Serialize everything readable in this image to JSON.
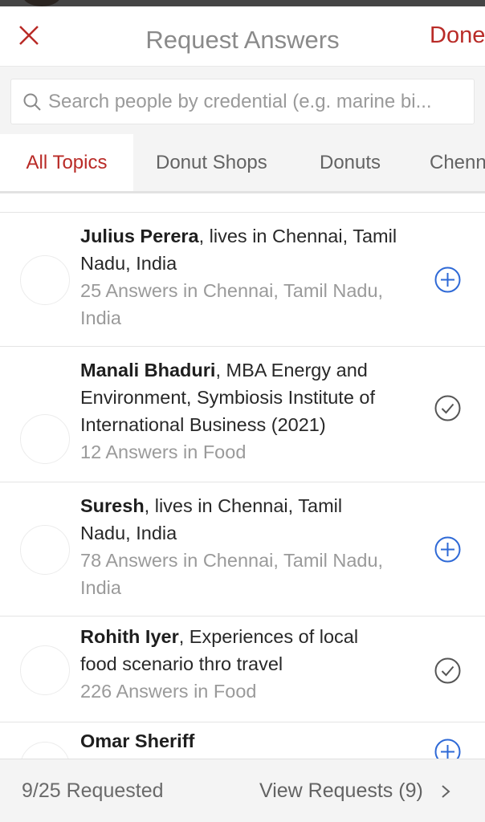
{
  "header": {
    "title": "Request Answers",
    "done_label": "Done",
    "close_icon": "close-icon"
  },
  "search": {
    "placeholder": "Search people by credential (e.g. marine bi..."
  },
  "tabs": [
    {
      "label": "All Topics",
      "active": true
    },
    {
      "label": "Donut Shops"
    },
    {
      "label": "Donuts"
    },
    {
      "label": "Chennai"
    }
  ],
  "people": [
    {
      "name": "Julius Perera",
      "credential": ", lives in Chennai, Tamil Nadu, India",
      "answers": "25 Answers in Chennai, Tamil Nadu, India",
      "state": "add"
    },
    {
      "name": "Manali Bhaduri",
      "credential": ", MBA Energy and Environment, Symbiosis Institute of International Business (2021)",
      "answers": "12 Answers in Food",
      "state": "requested"
    },
    {
      "name": "Suresh",
      "credential": ", lives in Chennai, Tamil Nadu, India",
      "answers": "78 Answers in Chennai, Tamil Nadu, India",
      "state": "add"
    },
    {
      "name": "Rohith Iyer",
      "credential": ", Experiences of local food scenario thro travel",
      "answers": "226 Answers in Food",
      "state": "requested"
    },
    {
      "name": "Omar Sheriff",
      "credential": "",
      "answers": "",
      "state": "add"
    }
  ],
  "footer": {
    "count": "9/25 Requested",
    "view_label": "View Requests (9)"
  },
  "colors": {
    "accent": "#b92b27",
    "add": "#2e69d6",
    "check": "#555555"
  }
}
